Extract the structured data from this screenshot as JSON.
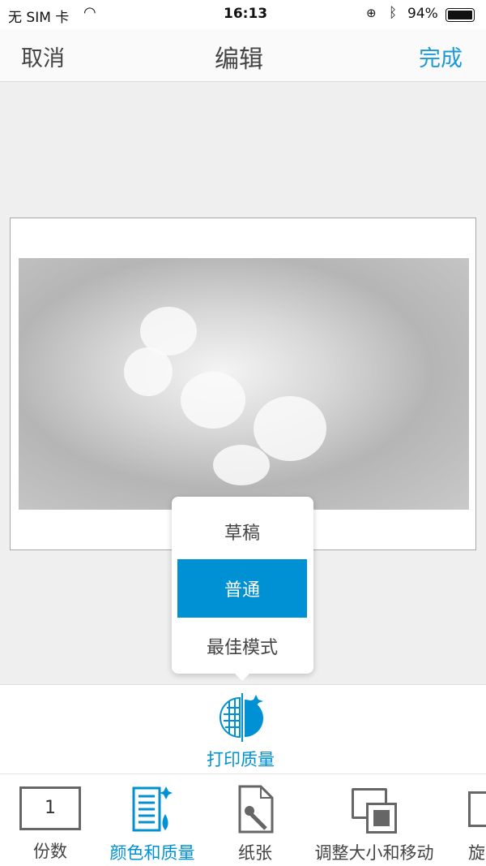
{
  "status_bar": {
    "carrier": "无 SIM 卡",
    "time": "16:13",
    "battery": "94%"
  },
  "nav": {
    "cancel": "取消",
    "title": "编辑",
    "done": "完成"
  },
  "colors": {
    "accent": "#0091d5"
  },
  "quality_popup": {
    "options": [
      "草稿",
      "普通",
      "最佳模式"
    ],
    "selected": "普通"
  },
  "panel": {
    "label": "打印质量",
    "icon": "print-quality-icon"
  },
  "toolbar": {
    "items": [
      {
        "label": "份数",
        "value": "1",
        "icon": "copies-icon"
      },
      {
        "label": "颜色和质量",
        "icon": "color-quality-icon",
        "active": true
      },
      {
        "label": "纸张",
        "icon": "paper-icon"
      },
      {
        "label": "调整大小和移动",
        "icon": "resize-move-icon"
      },
      {
        "label": "旋",
        "icon": "rotate-icon"
      }
    ]
  }
}
